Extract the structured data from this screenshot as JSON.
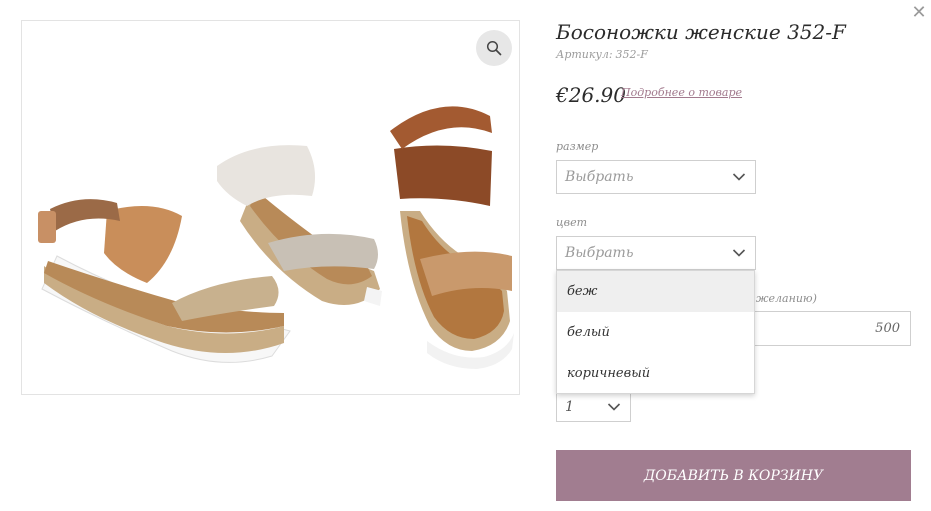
{
  "product": {
    "title": "Босоножки женские 352-F",
    "sku_label": "Артикул:",
    "sku_value": "352-F",
    "price": "€26.90",
    "details_link": "Подробнее о товаре",
    "image_alt": "Босоножки женские 352-F"
  },
  "options": {
    "size": {
      "label": "размер",
      "value": "Выбрать"
    },
    "color": {
      "label": "цвет",
      "value": "Выбрать",
      "open": true,
      "items": [
        "беж",
        "белый",
        "коричневый"
      ],
      "highlighted_index": 0
    },
    "extra": {
      "label_visible_fragment": "желанию)",
      "value": "500"
    },
    "quantity": {
      "value": "1"
    }
  },
  "cart": {
    "add_button": "ДОБАВИТЬ В КОРЗИНУ"
  },
  "icons": {
    "close": "close-icon",
    "zoom": "search-icon",
    "chevron": "chevron-down-icon"
  },
  "colors": {
    "accent": "#a17d90",
    "link": "#a2798d",
    "highlight": "#efefef"
  }
}
